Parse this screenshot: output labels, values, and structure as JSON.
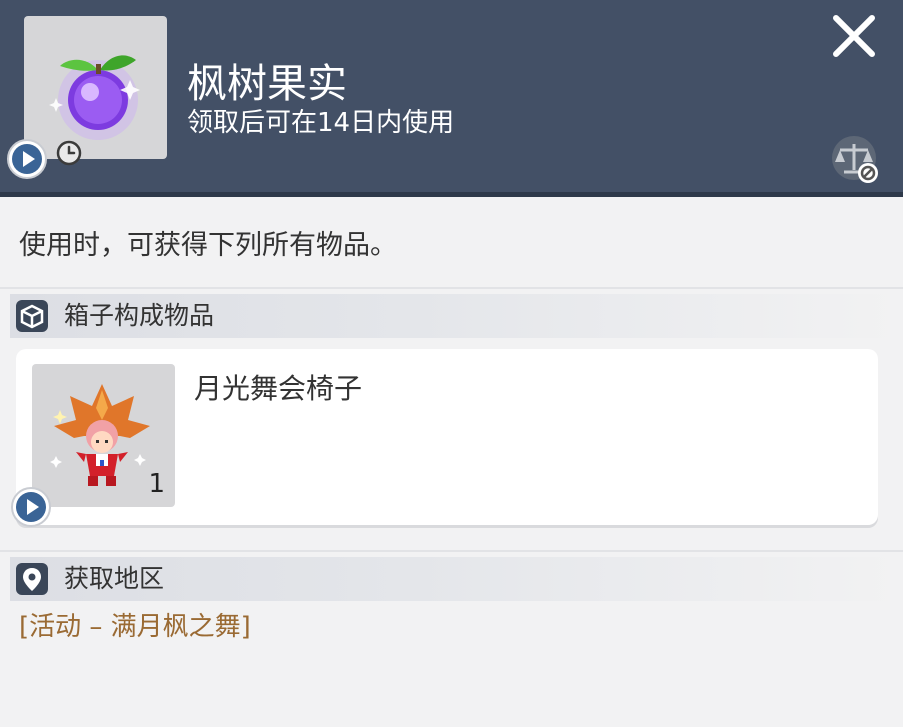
{
  "item": {
    "title": "枫树果实",
    "subtitle": "领取后可在14日内使用",
    "icon": "purple-fruit-icon"
  },
  "header": {
    "close_icon": "close-icon",
    "trade_icon": "trade-restricted-icon"
  },
  "description": "使用时，可获得下列所有物品。",
  "box_section": {
    "title": "箱子构成物品",
    "icon": "box-icon",
    "items": [
      {
        "name": "月光舞会椅子",
        "quantity": "1",
        "icon": "maple-leaf-character-icon"
      }
    ]
  },
  "region_section": {
    "title": "获取地区",
    "icon": "location-pin-icon",
    "region": "[活动 – 满月枫之舞]"
  },
  "colors": {
    "header_bg": "#435066",
    "body_bg": "#f2f2f3",
    "region_text": "#9a6a33"
  }
}
